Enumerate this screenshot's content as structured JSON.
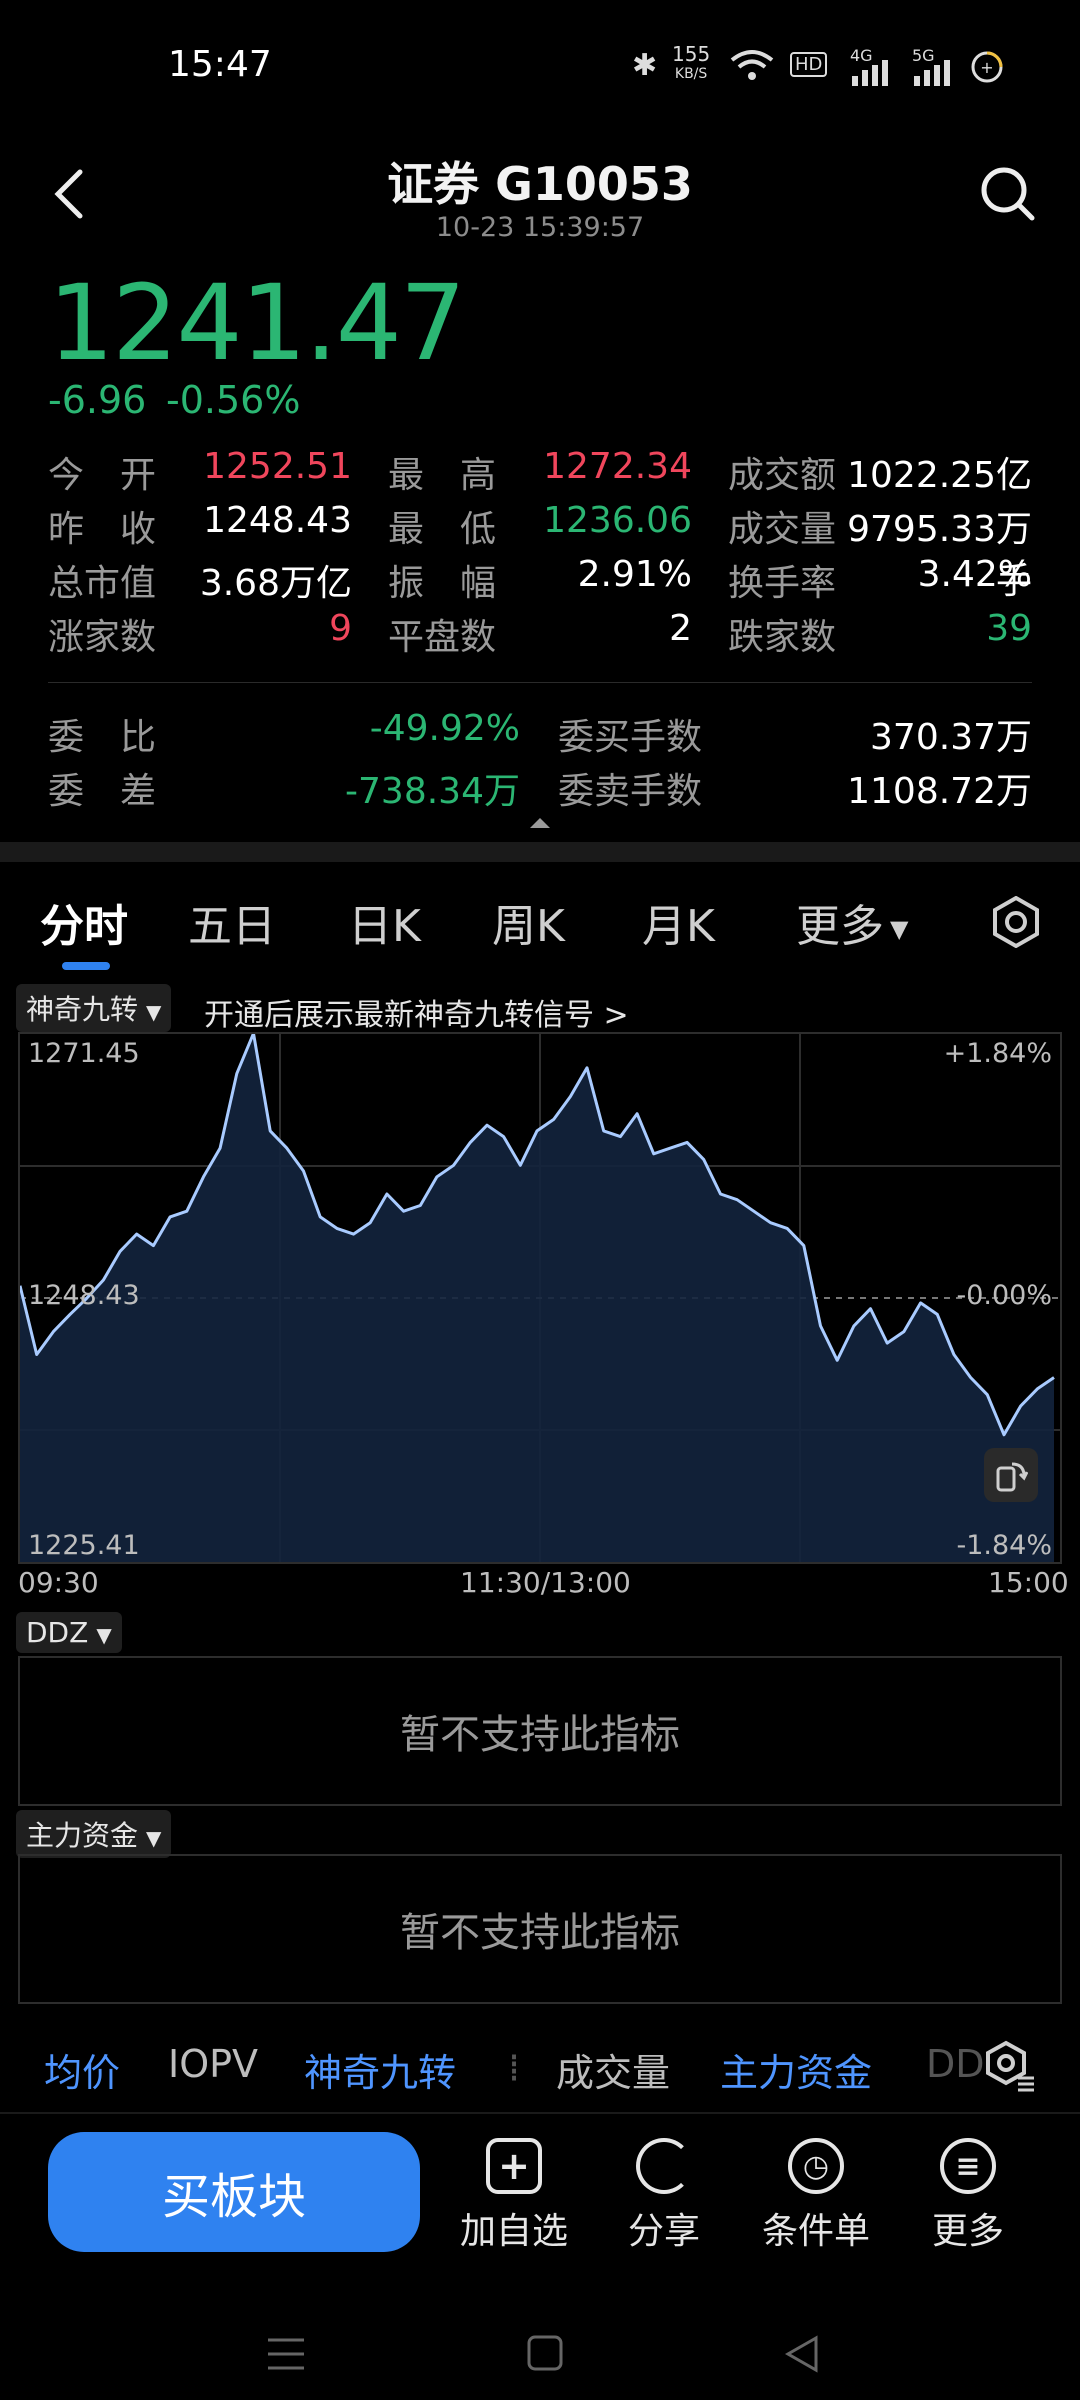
{
  "status_bar": {
    "time": "15:47",
    "speed_value": "155",
    "speed_unit": "KB/S",
    "hd_badge": "HD",
    "net1": "4G",
    "net2": "5G"
  },
  "header": {
    "title": "证券 G10053",
    "timestamp": "10-23 15:39:57"
  },
  "quote": {
    "price": "1241.47",
    "change": "-6.96",
    "change_pct": "-0.56%"
  },
  "stats": [
    {
      "label": "今　开",
      "value": "1252.51",
      "tone": "red"
    },
    {
      "label": "最　高",
      "value": "1272.34",
      "tone": "red"
    },
    {
      "label": "成交额",
      "value": "1022.25亿",
      "tone": "white"
    },
    {
      "label": "昨　收",
      "value": "1248.43",
      "tone": "white"
    },
    {
      "label": "最　低",
      "value": "1236.06",
      "tone": "green"
    },
    {
      "label": "成交量",
      "value": "9795.33万手",
      "tone": "white"
    },
    {
      "label": "总市值",
      "value": "3.68万亿",
      "tone": "white"
    },
    {
      "label": "振　幅",
      "value": "2.91%",
      "tone": "white"
    },
    {
      "label": "换手率",
      "value": "3.42%",
      "tone": "white"
    },
    {
      "label": "涨家数",
      "value": "9",
      "tone": "red"
    },
    {
      "label": "平盘数",
      "value": "2",
      "tone": "white"
    },
    {
      "label": "跌家数",
      "value": "39",
      "tone": "green"
    }
  ],
  "order_stats": [
    {
      "label": "委　比",
      "value": "-49.92%",
      "tone": "green"
    },
    {
      "label": "委买手数",
      "value": "370.37万",
      "tone": "white"
    },
    {
      "label": "委　差",
      "value": "-738.34万",
      "tone": "green"
    },
    {
      "label": "委卖手数",
      "value": "1108.72万",
      "tone": "white"
    }
  ],
  "tabs": [
    "分时",
    "五日",
    "日K",
    "周K",
    "月K",
    "更多"
  ],
  "indicator": {
    "name": "神奇九转",
    "hint": "开通后展示最新神奇九转信号 >"
  },
  "chart_data": {
    "type": "area",
    "y_top_label": "1271.45",
    "y_mid_label": "1248.43",
    "y_bottom_label": "1225.41",
    "pct_top_label": "+1.84%",
    "pct_mid_label": "0.00%",
    "pct_bottom_label": "-1.84%",
    "x_labels": [
      "09:30",
      "11:30/13:00",
      "15:00"
    ],
    "ylim": [
      1225.41,
      1271.45
    ],
    "baseline": 1248.43,
    "values": [
      1249.5,
      1243.5,
      1245.5,
      1247.0,
      1248.4,
      1250.0,
      1252.5,
      1254.0,
      1253.0,
      1255.5,
      1256.0,
      1259.0,
      1261.5,
      1268.0,
      1271.5,
      1263.0,
      1261.5,
      1259.5,
      1255.5,
      1254.5,
      1254.0,
      1255.0,
      1257.5,
      1256.0,
      1256.5,
      1259.0,
      1260.0,
      1262.0,
      1263.5,
      1262.5,
      1260.0,
      1263.0,
      1264.0,
      1266.0,
      1268.5,
      1263.0,
      1262.5,
      1264.5,
      1261.0,
      1261.5,
      1262.0,
      1260.5,
      1257.5,
      1257.0,
      1256.0,
      1255.0,
      1254.5,
      1253.0,
      1246.0,
      1243.0,
      1246.0,
      1247.5,
      1244.5,
      1245.5,
      1248.0,
      1247.0,
      1243.5,
      1241.5,
      1240.0,
      1236.5,
      1239.0,
      1240.5,
      1241.5
    ]
  },
  "panels": [
    {
      "label": "DDZ",
      "message": "暂不支持此指标"
    },
    {
      "label": "主力资金",
      "message": "暂不支持此指标"
    }
  ],
  "bottom_tabs": [
    {
      "label": "均价",
      "tone": "blue"
    },
    {
      "label": "IOPV",
      "tone": "grey"
    },
    {
      "label": "神奇九转",
      "tone": "blue"
    },
    {
      "label": "成交量",
      "tone": "grey"
    },
    {
      "label": "主力资金",
      "tone": "blue"
    },
    {
      "label": "DD",
      "tone": "dim"
    }
  ],
  "actions": {
    "buy": "买板块",
    "add": "加自选",
    "share": "分享",
    "cond": "条件单",
    "more": "更多"
  },
  "colors": {
    "up": "#f0465c",
    "down": "#2bb673",
    "accent": "#2f82f0",
    "line": "#a9cbff"
  }
}
